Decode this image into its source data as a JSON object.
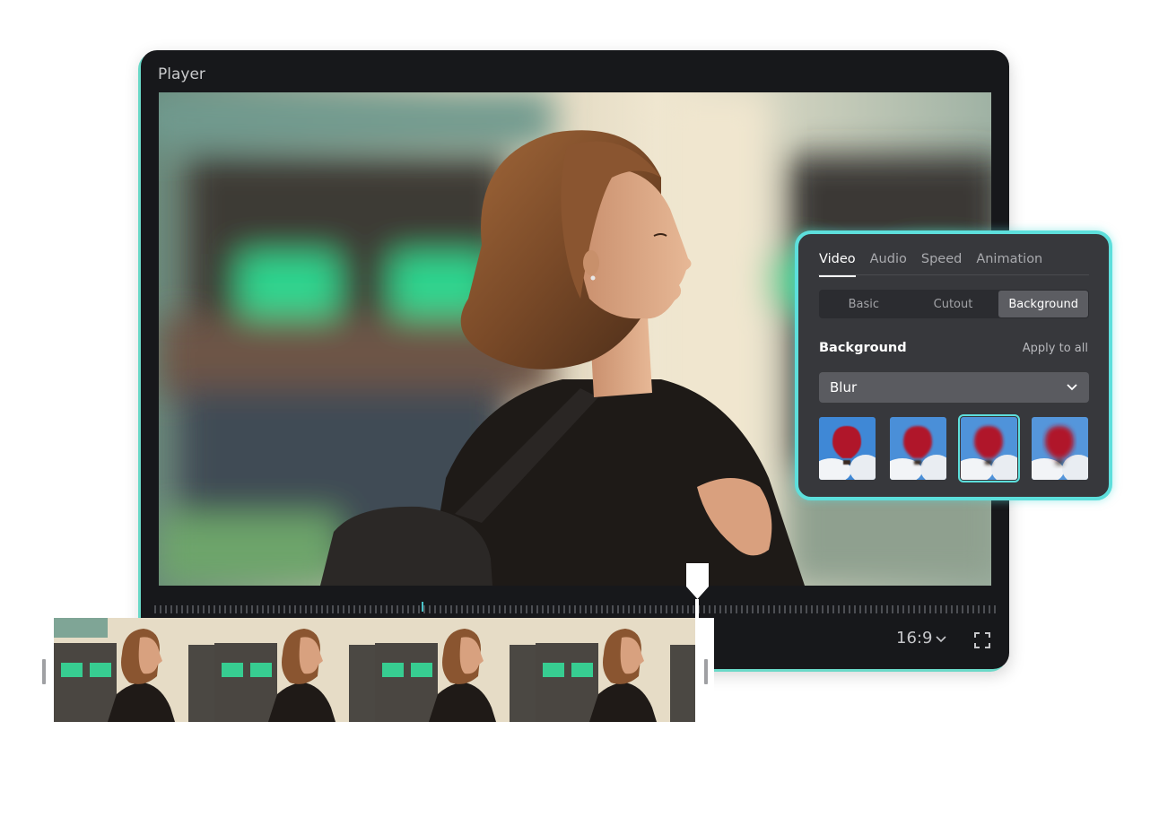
{
  "player": {
    "title": "Player",
    "aspect_ratio": "16:9",
    "icons": {
      "aspect_dropdown": "chevron-down-icon",
      "fullscreen": "fullscreen-icon"
    }
  },
  "panel": {
    "tabs": [
      {
        "label": "Video",
        "active": true
      },
      {
        "label": "Audio",
        "active": false
      },
      {
        "label": "Speed",
        "active": false
      },
      {
        "label": "Animation",
        "active": false
      }
    ],
    "subtabs": [
      {
        "label": "Basic",
        "active": false
      },
      {
        "label": "Cutout",
        "active": false
      },
      {
        "label": "Background",
        "active": true
      }
    ],
    "section_title": "Background",
    "apply_all": "Apply to all",
    "background_type": "Blur",
    "blur_presets_count": 4,
    "selected_preset": 3
  },
  "colors": {
    "accent": "#5ddfdc",
    "player_bg": "#17181b",
    "panel_bg": "#37383c",
    "playhead_marker": "#49c3c8"
  }
}
